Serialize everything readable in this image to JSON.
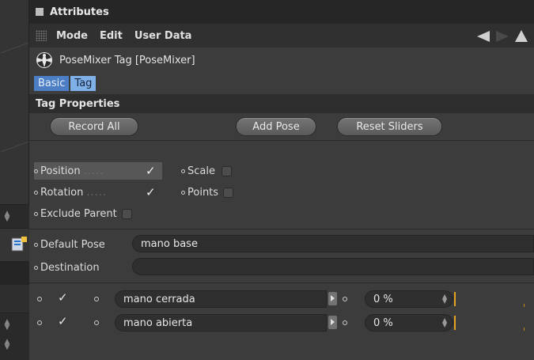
{
  "window": {
    "title": "Attributes"
  },
  "menu": {
    "items": [
      "Mode",
      "Edit",
      "User Data"
    ]
  },
  "object": {
    "name": "PoseMixer Tag [PoseMixer]"
  },
  "tabs": {
    "basic": "Basic",
    "tag": "Tag",
    "active": "Tag"
  },
  "section": {
    "title": "Tag Properties"
  },
  "buttons": {
    "record_all": "Record All",
    "add_pose": "Add Pose",
    "reset_sliders": "Reset Sliders"
  },
  "props": {
    "position": {
      "label": "Position",
      "dots": ".....",
      "checked": true
    },
    "rotation": {
      "label": "Rotation",
      "dots": ".....",
      "checked": true
    },
    "scale": {
      "label": "Scale",
      "checked": false
    },
    "points": {
      "label": "Points",
      "checked": false
    },
    "exclude_parent": {
      "label": "Exclude Parent",
      "checked": false
    }
  },
  "links": {
    "default_pose": {
      "label": "Default Pose",
      "value": "mano base"
    },
    "destination": {
      "label": "Destination",
      "value": ""
    }
  },
  "poses": [
    {
      "name": "mano cerrada",
      "value": "0 %",
      "enabled": true
    },
    {
      "name": "mano abierta",
      "value": "0 %",
      "enabled": true
    }
  ],
  "colors": {
    "accent": "#e6a21e",
    "tab_active": "#7fb0e8",
    "tab_inactive": "#4b7ec4"
  }
}
